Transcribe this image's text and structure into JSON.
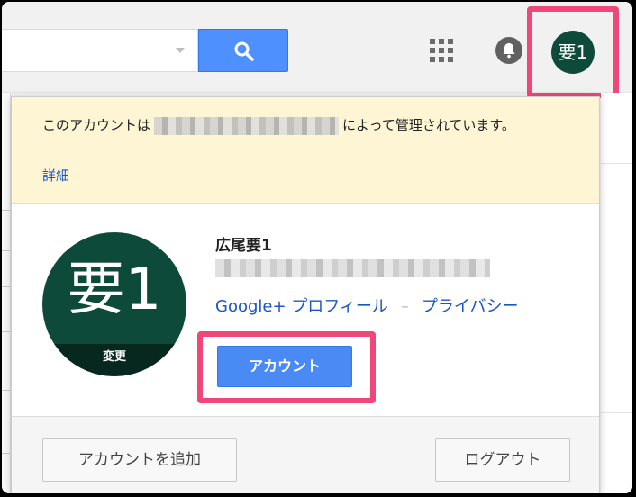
{
  "header": {
    "search_placeholder": "",
    "apps_icon": "apps-grid-icon",
    "notifications_icon": "bell-icon",
    "account_avatar_initials": "要1"
  },
  "account_popup": {
    "notice": {
      "text_before": "このアカウントは",
      "text_after": "によって管理されています。",
      "details_link": "詳細"
    },
    "avatar": {
      "initials": "要1",
      "change_label": "変更"
    },
    "user_name": "広尾要1",
    "links": {
      "profile": "Google+ プロフィール",
      "separator": "–",
      "privacy": "プライバシー"
    },
    "account_button": "アカウント",
    "footer": {
      "add_account": "アカウントを追加",
      "sign_out": "ログアウト"
    }
  },
  "colors": {
    "accent_blue": "#4a8af4",
    "avatar_green": "#0d4a3a",
    "highlight_pink": "#f0477a",
    "notice_yellow": "#fdf5d4"
  }
}
